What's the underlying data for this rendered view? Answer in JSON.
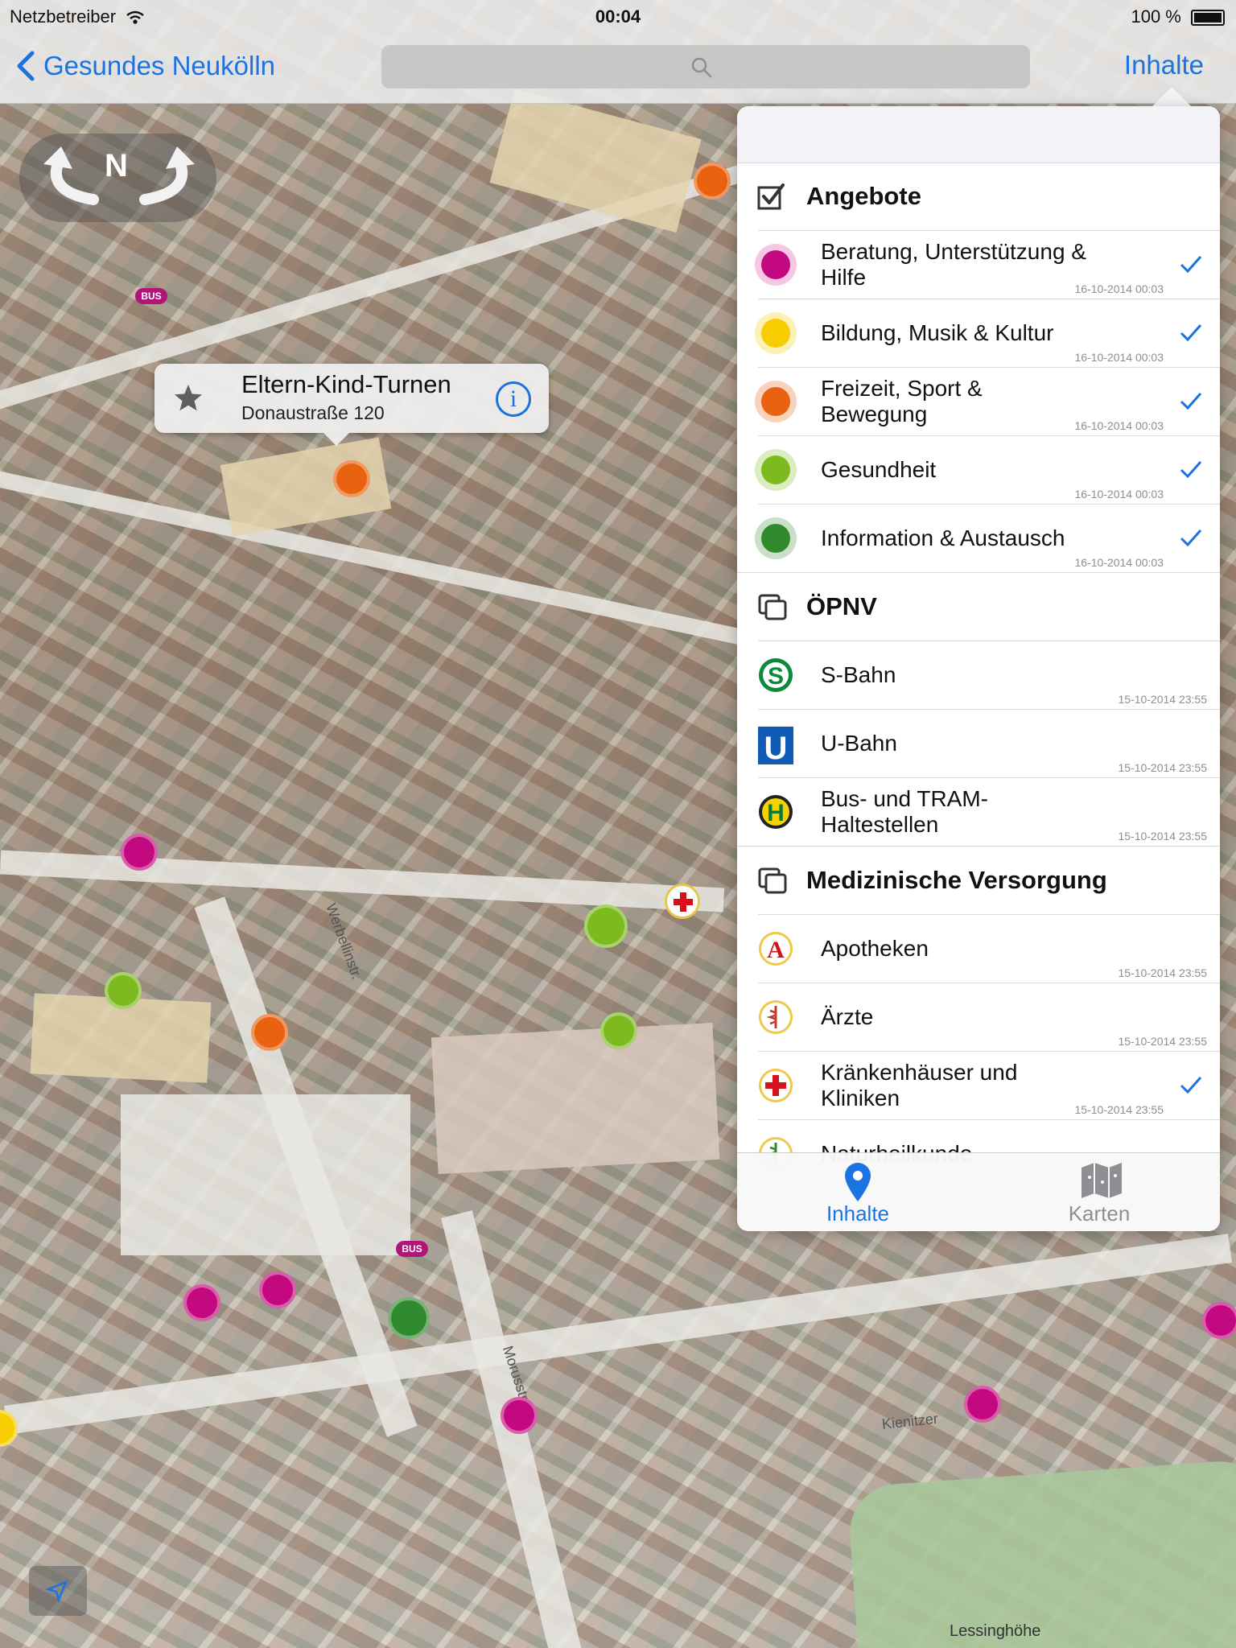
{
  "status_bar": {
    "carrier": "Netzbetreiber",
    "time": "00:04",
    "battery": "100 %"
  },
  "nav": {
    "back_label": "Gesundes Neukölln",
    "search_placeholder": "",
    "right_button": "Inhalte"
  },
  "compass": {
    "north": "N"
  },
  "map": {
    "callout": {
      "title": "Eltern-Kind-Turnen",
      "subtitle": "Donaustraße 120"
    },
    "bus_badge": "BUS",
    "street_labels": [
      "Morusstraße",
      "Kienitzer",
      "Lessinghöhe",
      "Werbellinstr."
    ]
  },
  "colors": {
    "accent": "#1a73e0",
    "magenta": "#c3097f",
    "yellow": "#f7cc00",
    "orange": "#e8620f",
    "lime": "#7cba1f",
    "green": "#2f8a2e",
    "s_bahn": "#0a8a3a",
    "u_bahn": "#0f5bb5"
  },
  "popover": {
    "sections": [
      {
        "title": "Angebote",
        "icon": "checkbox-icon",
        "rows": [
          {
            "label": "Beratung, Unterstützung & Hilfe",
            "timestamp": "16-10-2014 00:03",
            "icon": "magenta-dot-icon",
            "checked": true
          },
          {
            "label": "Bildung, Musik & Kultur",
            "timestamp": "16-10-2014 00:03",
            "icon": "yellow-dot-icon",
            "checked": true
          },
          {
            "label": "Freizeit, Sport & Bewegung",
            "timestamp": "16-10-2014 00:03",
            "icon": "orange-dot-icon",
            "checked": true
          },
          {
            "label": "Gesundheit",
            "timestamp": "16-10-2014 00:03",
            "icon": "lime-dot-icon",
            "checked": true
          },
          {
            "label": "Information & Austausch",
            "timestamp": "16-10-2014 00:03",
            "icon": "green-dot-icon",
            "checked": true
          }
        ]
      },
      {
        "title": "ÖPNV",
        "icon": "layers-icon",
        "rows": [
          {
            "label": "S-Bahn",
            "timestamp": "15-10-2014 23:55",
            "icon": "s-bahn-icon",
            "checked": false
          },
          {
            "label": "U-Bahn",
            "timestamp": "15-10-2014 23:55",
            "icon": "u-bahn-icon",
            "checked": false
          },
          {
            "label": "Bus- und TRAM-Haltestellen",
            "timestamp": "15-10-2014 23:55",
            "icon": "bus-stop-icon",
            "checked": false
          }
        ]
      },
      {
        "title": "Medizinische Versorgung",
        "icon": "layers-icon",
        "rows": [
          {
            "label": "Apotheken",
            "timestamp": "15-10-2014 23:55",
            "icon": "pharmacy-icon",
            "checked": false
          },
          {
            "label": "Ärzte",
            "timestamp": "15-10-2014 23:55",
            "icon": "doctor-icon",
            "checked": false
          },
          {
            "label": "Kränkenhäuser und Kliniken",
            "timestamp": "15-10-2014 23:55",
            "icon": "hospital-icon",
            "checked": true
          },
          {
            "label": "Naturheilkunde",
            "timestamp": "",
            "icon": "naturopathy-icon",
            "checked": false
          }
        ]
      }
    ],
    "tabs": [
      {
        "label": "Inhalte",
        "icon": "location-pin-icon",
        "active": true
      },
      {
        "label": "Karten",
        "icon": "map-icon",
        "active": false
      }
    ]
  }
}
